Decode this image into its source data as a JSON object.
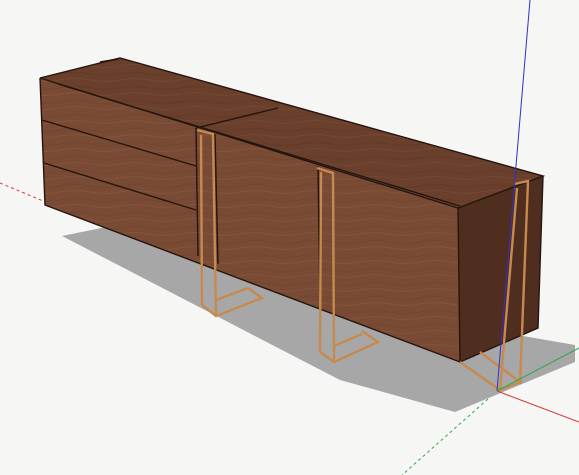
{
  "viewport": {
    "background": "#f6f6f5",
    "texture_color": "#e3e3e1"
  },
  "axes": {
    "red": "#d43a3a",
    "green": "#2fa84a",
    "blue": "#3030c8"
  },
  "model": {
    "subject": "sideboard",
    "wood_light": "#7a4b34",
    "wood_mid": "#6a3f2b",
    "wood_dark": "#4f2d1f",
    "edge": "#241510",
    "brass": "#c68a4e",
    "brass_dark": "#8a5a30",
    "shadow": "#a7a7a7"
  }
}
